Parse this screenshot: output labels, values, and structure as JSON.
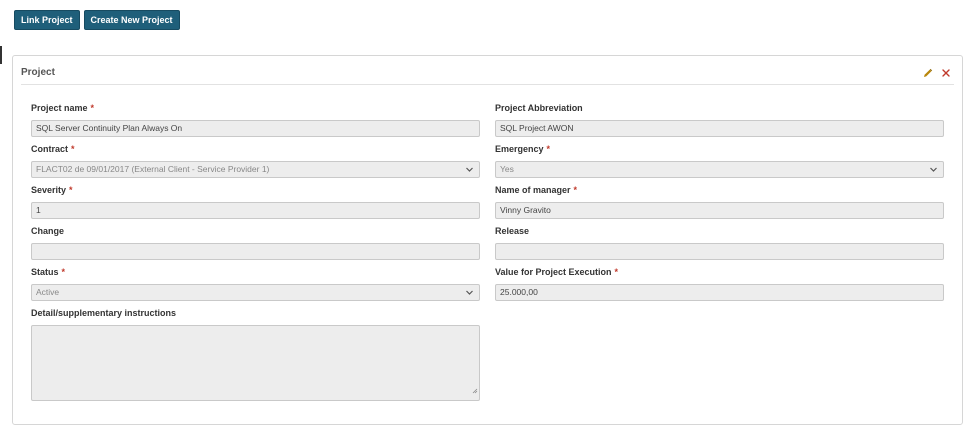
{
  "toolbar": {
    "link_project": "Link Project",
    "create_new_project": "Create New Project"
  },
  "panel": {
    "title": "Project",
    "edit_icon": "pencil-icon",
    "close_icon": "close-icon"
  },
  "form": {
    "project_name": {
      "label": "Project name",
      "required": "*",
      "value": "SQL Server Continuity Plan Always On"
    },
    "project_abbreviation": {
      "label": "Project Abbreviation",
      "value": "SQL Project AWON"
    },
    "contract": {
      "label": "Contract",
      "required": "*",
      "value": "FLACT02 de 09/01/2017 (External Client - Service Provider 1)"
    },
    "emergency": {
      "label": "Emergency",
      "required": "*",
      "value": "Yes"
    },
    "severity": {
      "label": "Severity",
      "required": "*",
      "value": "1"
    },
    "name_of_manager": {
      "label": "Name of manager",
      "required": "*",
      "value": "Vinny Gravito"
    },
    "change": {
      "label": "Change",
      "value": ""
    },
    "release": {
      "label": "Release",
      "value": ""
    },
    "status": {
      "label": "Status",
      "required": "*",
      "value": "Active"
    },
    "value_for_project_execution": {
      "label": "Value for Project Execution",
      "required": "*",
      "value": "25.000,00"
    },
    "detail_instructions": {
      "label": "Detail/supplementary instructions",
      "value": ""
    }
  },
  "colors": {
    "primary_button": "#1f5f7a",
    "required_marker": "#c0392b",
    "edit_icon": "#b8860b",
    "close_icon": "#c0392b"
  }
}
